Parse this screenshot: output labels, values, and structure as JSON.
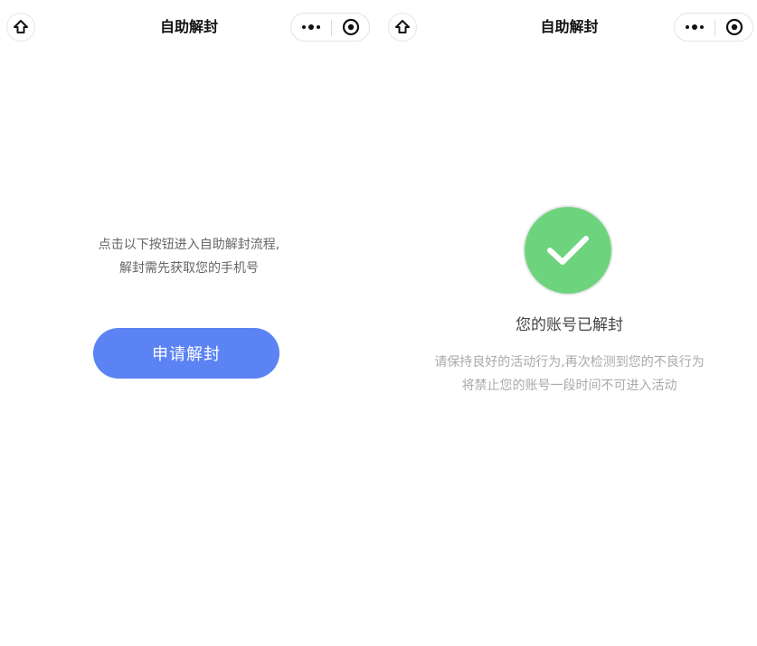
{
  "left_screen": {
    "nav_title": "自助解封",
    "home_icon": "home-icon",
    "more_icon": "more-dots-icon",
    "close_icon": "target-close-icon",
    "intro_line1": "点击以下按钮进入自助解封流程,",
    "intro_line2": "解封需先获取您的手机号",
    "apply_button": "申请解封",
    "button_color": "#5b83f4"
  },
  "right_screen": {
    "nav_title": "自助解封",
    "home_icon": "home-icon",
    "more_icon": "more-dots-icon",
    "close_icon": "target-close-icon",
    "success_icon": "check-circle-icon",
    "success_color": "#6ed37d",
    "result_title": "您的账号已解封",
    "desc_line1": "请保持良好的活动行为,再次检测到您的不良行为",
    "desc_line2": "将禁止您的账号一段时间不可进入活动"
  }
}
